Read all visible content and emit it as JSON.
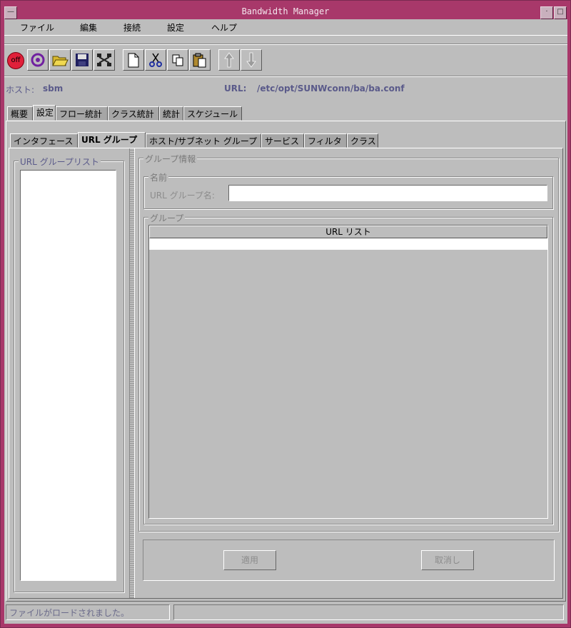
{
  "window": {
    "title": "Bandwidth Manager"
  },
  "menu": [
    "ファイル",
    "編集",
    "接続",
    "設定",
    "ヘルプ"
  ],
  "toolbar": {
    "buttons": [
      "off-icon",
      "connect-icon",
      "open-folder-icon",
      "save-icon",
      "network-icon",
      "new-file-icon",
      "cut-icon",
      "copy-icon",
      "paste-icon",
      "up-arrow-icon",
      "down-arrow-icon"
    ],
    "off_label": "off"
  },
  "info": {
    "host_label": "ホスト:",
    "host_value": "sbm",
    "url_label": "URL:",
    "url_value": "/etc/opt/SUNWconn/ba/ba.conf"
  },
  "main_tabs": [
    "概要",
    "設定",
    "フロー統計",
    "クラス統計",
    "統計",
    "スケジュール"
  ],
  "sub_tabs": [
    "インタフェース",
    "URL グループ",
    "ホスト/サブネット グループ",
    "サービス",
    "フィルタ",
    "クラス"
  ],
  "url_group_list": {
    "title": "URL グループリスト",
    "items": []
  },
  "group_info": {
    "title": "グループ情報",
    "name_section": "名前",
    "name_label": "URL グループ名:",
    "name_value": "",
    "group_section": "グループ",
    "table_header": "URL リスト",
    "rows": [
      ""
    ]
  },
  "buttons": {
    "apply": "適用",
    "cancel": "取消し"
  },
  "status": {
    "message": "ファイルがロードされました。",
    "secondary": ""
  },
  "colors": {
    "title_bar": "#a8386a",
    "background": "#bdbdbd",
    "label_blue": "#5a5a8a"
  }
}
